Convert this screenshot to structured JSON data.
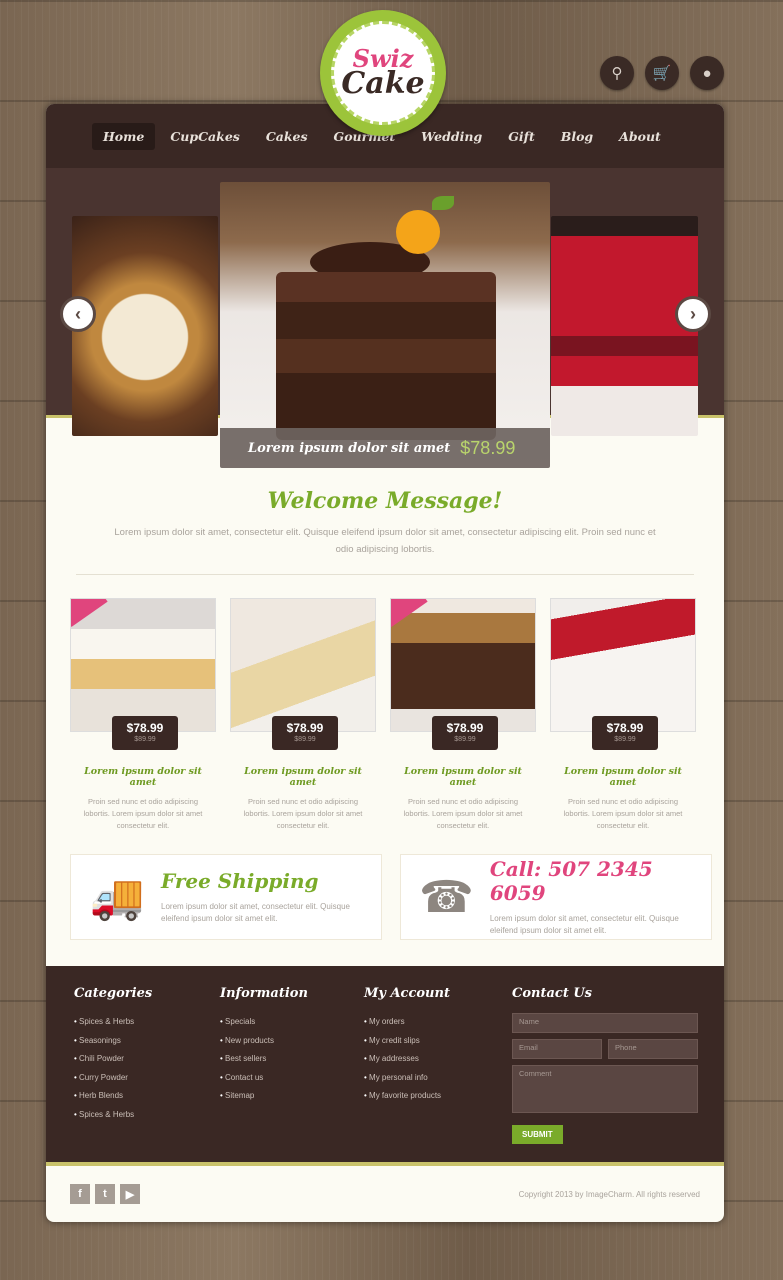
{
  "logo": {
    "line1": "Swiz",
    "line2": "Cake"
  },
  "header_icons": [
    {
      "name": "search-icon",
      "glyph": "⚲"
    },
    {
      "name": "cart-icon",
      "glyph": "🛒"
    },
    {
      "name": "user-icon",
      "glyph": "●"
    }
  ],
  "nav": [
    "Home",
    "CupCakes",
    "Cakes",
    "Gourmet",
    "Wedding",
    "Gift",
    "Blog",
    "About"
  ],
  "slider": {
    "caption": "Lorem ipsum dolor sit amet",
    "price": "$78.99",
    "prev_glyph": "‹",
    "next_glyph": "›"
  },
  "welcome": {
    "title": "Welcome Message!",
    "text": "Lorem ipsum dolor sit amet, consectetur elit. Quisque eleifend ipsum dolor sit amet, consectetur adipiscing elit. Proin sed nunc et odio adipiscing lobortis."
  },
  "products": [
    {
      "price": "$78.99",
      "old": "$89.99",
      "name": "Lorem ipsum dolor sit amet",
      "desc": "Proin sed nunc et odio adipiscing lobortis. Lorem ipsum dolor sit amet consectetur elit."
    },
    {
      "price": "$78.99",
      "old": "$89.99",
      "name": "Lorem ipsum dolor sit amet",
      "desc": "Proin sed nunc et odio adipiscing lobortis. Lorem ipsum dolor sit amet consectetur elit."
    },
    {
      "price": "$78.99",
      "old": "$89.99",
      "name": "Lorem ipsum dolor sit amet",
      "desc": "Proin sed nunc et odio adipiscing lobortis. Lorem ipsum dolor sit amet consectetur elit."
    },
    {
      "price": "$78.99",
      "old": "$89.99",
      "name": "Lorem ipsum dolor sit amet",
      "desc": "Proin sed nunc et odio adipiscing lobortis. Lorem ipsum dolor sit amet consectetur elit."
    }
  ],
  "features": {
    "shipping": {
      "title": "Free Shipping",
      "text": "Lorem ipsum dolor sit amet, consectetur elit. Quisque eleifend ipsum dolor sit amet elit."
    },
    "call": {
      "title": "Call: 507 2345 6059",
      "text": "Lorem ipsum dolor sit amet, consectetur elit. Quisque eleifend ipsum dolor sit amet elit."
    }
  },
  "footer": {
    "categories": {
      "title": "Categories",
      "items": [
        "Spices & Herbs",
        "Seasonings",
        "Chili Powder",
        "Curry Powder",
        "Herb Blends",
        "Spices & Herbs"
      ]
    },
    "information": {
      "title": "Information",
      "items": [
        "Specials",
        "New products",
        "Best sellers",
        "Contact us",
        "Sitemap"
      ]
    },
    "account": {
      "title": "My Account",
      "items": [
        "My orders",
        "My credit slips",
        "My addresses",
        "My personal info",
        "My favorite products"
      ]
    },
    "contact": {
      "title": "Contact Us",
      "name_ph": "Name",
      "email_ph": "Email",
      "phone_ph": "Phone",
      "comment_ph": "Comment",
      "submit": "SUBMIT"
    }
  },
  "bottom": {
    "socials": [
      "f",
      "t",
      "▶"
    ],
    "copyright": "Copyright 2013 by ImageCharm. All rights reserved"
  },
  "colors": {
    "accent_green": "#7aab2a",
    "accent_pink": "#e0457d",
    "dark_brown": "#3a2824"
  }
}
